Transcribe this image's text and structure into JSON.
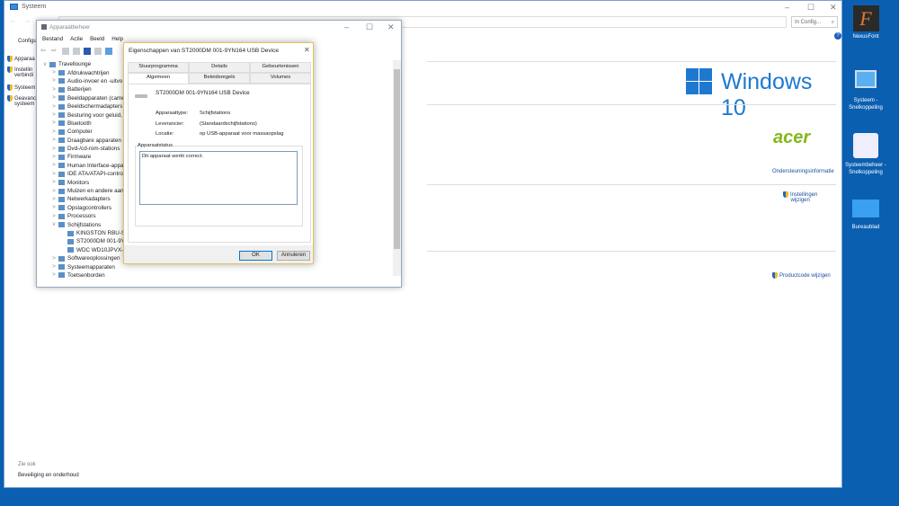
{
  "system": {
    "title": "Systeem",
    "search_placeholder": "In Config...",
    "config_label": "Configu",
    "left_links": [
      "Apparaa",
      "Instellin",
      "verbindi",
      "Systeem",
      "Geavanc",
      "systeem"
    ],
    "windows_logo": "Windows 10",
    "oem_logo": "acer",
    "support_link": "Ondersteuningsinformatie",
    "settings_link_1": "Instellingen",
    "settings_link_2": "wijzigen",
    "product_key_link": "Productcode wijzigen",
    "see_also": "Zie ook",
    "security_link": "Beveiliging en onderhoud"
  },
  "devmgr": {
    "title": "Apparaatbeheer",
    "menu": [
      "Bestand",
      "Actie",
      "Beeld",
      "Help"
    ],
    "tree": [
      {
        "label": "Travellounge",
        "level": 0,
        "chev": "v"
      },
      {
        "label": "Afdrukwachtrijen",
        "level": 1,
        "chev": ">"
      },
      {
        "label": "Audio-invoer en -uitvo",
        "level": 1,
        "chev": ">"
      },
      {
        "label": "Batterijen",
        "level": 1,
        "chev": ">"
      },
      {
        "label": "Beeldapparaten (camer",
        "level": 1,
        "chev": ">"
      },
      {
        "label": "Beeldschermadapters",
        "level": 1,
        "chev": ">"
      },
      {
        "label": "Besturing voor geluid, v",
        "level": 1,
        "chev": ">"
      },
      {
        "label": "Bluetooth",
        "level": 1,
        "chev": ">"
      },
      {
        "label": "Computer",
        "level": 1,
        "chev": ">"
      },
      {
        "label": "Draagbare apparaten",
        "level": 1,
        "chev": ">"
      },
      {
        "label": "Dvd-/cd-rom-stations",
        "level": 1,
        "chev": ">"
      },
      {
        "label": "Firmware",
        "level": 1,
        "chev": ">"
      },
      {
        "label": "Human Interface-appa",
        "level": 1,
        "chev": ">"
      },
      {
        "label": "IDE ATA/ATAPI-control",
        "level": 1,
        "chev": ">"
      },
      {
        "label": "Monitors",
        "level": 1,
        "chev": ">"
      },
      {
        "label": "Muizen en andere aanv",
        "level": 1,
        "chev": ">"
      },
      {
        "label": "Netwerkadapters",
        "level": 1,
        "chev": ">"
      },
      {
        "label": "Opslagcontrollers",
        "level": 1,
        "chev": ">"
      },
      {
        "label": "Processors",
        "level": 1,
        "chev": ">"
      },
      {
        "label": "Schijfstations",
        "level": 1,
        "chev": "v"
      },
      {
        "label": "KINGSTON RBU-SN",
        "level": 2,
        "chev": ""
      },
      {
        "label": "ST2000DM 001-9YN",
        "level": 2,
        "chev": ""
      },
      {
        "label": "WDC WD10JPVX-22",
        "level": 2,
        "chev": ""
      },
      {
        "label": "Softwareoplossingen",
        "level": 1,
        "chev": ">"
      },
      {
        "label": "Systeemapparaten",
        "level": 1,
        "chev": ">"
      },
      {
        "label": "Toetsenborden",
        "level": 1,
        "chev": ">"
      }
    ]
  },
  "dialog": {
    "title": "Eigenschappen van ST2000DM 001-9YN164 USB Device",
    "tabs_top": [
      "Stuurprogramma",
      "Details",
      "Gebeurtenissen"
    ],
    "tabs_bottom": [
      "Algemeen",
      "Beleidsregels",
      "Volumes"
    ],
    "device_name": "ST2000DM 001-9YN164 USB Device",
    "props": [
      {
        "k": "Apparaattype:",
        "v": "Schijfstations"
      },
      {
        "k": "Leverancier:",
        "v": "(Standaardschijfstations)"
      },
      {
        "k": "Locatie:",
        "v": "op USB-apparaat voor massaopslag"
      }
    ],
    "status_group": "Apparaatstatus",
    "status_text": "Dit apparaat werkt correct.",
    "ok": "OK",
    "cancel": "Annuleren"
  },
  "desktop": [
    {
      "label": "NexusFont",
      "glyph": "F"
    },
    {
      "label": "Systeem - Snelkoppeling"
    },
    {
      "label": "Systeembeheer - Snelkoppeling"
    },
    {
      "label": "Bureaublad"
    }
  ]
}
